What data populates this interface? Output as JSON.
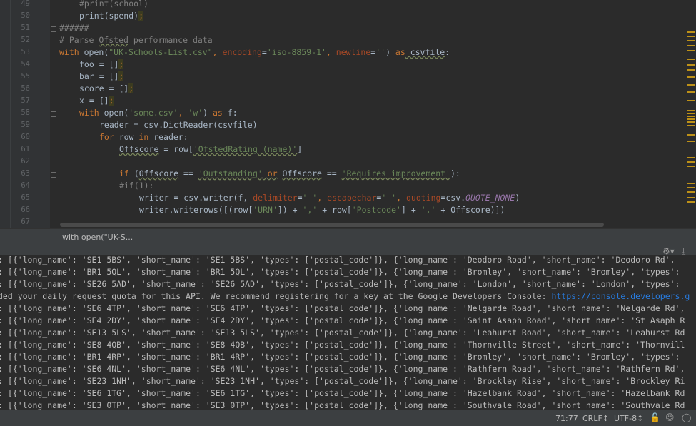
{
  "editor": {
    "line_numbers": [
      "49",
      "50",
      "51",
      "52",
      "53",
      "54",
      "55",
      "56",
      "57",
      "58",
      "59",
      "60",
      "61",
      "62",
      "63",
      "64",
      "65",
      "66",
      "67"
    ],
    "code": {
      "l49": "#print(school)",
      "l50_a": "print(spend)",
      "l50_b": ";",
      "l51": "######",
      "l52_a": "# Parse ",
      "l52_b": "Ofsted",
      "l52_c": " performance data",
      "l53_kw": "with",
      "l53_fn": " open(",
      "l53_s1": "\"UK-Schools-List.csv\"",
      "l53_c1": ", ",
      "l53_p1": "encoding",
      "l53_eq1": "=",
      "l53_s2": "'iso-8859-1'",
      "l53_c2": ", ",
      "l53_p2": "newline",
      "l53_eq2": "=",
      "l53_s3": "''",
      "l53_close": ") ",
      "l53_as": "as",
      "l53_var": " csvfile",
      "l53_colon": ":",
      "l54_a": "foo = []",
      "l54_b": ";",
      "l55_a": "bar = []",
      "l55_b": ";",
      "l56_a": "score = []",
      "l56_b": ";",
      "l57_a": "x = []",
      "l57_b": ";",
      "l58_kw": "with",
      "l58_a": " open(",
      "l58_s1": "'some.csv'",
      "l58_c": ", ",
      "l58_s2": "'w'",
      "l58_b": ") ",
      "l58_as": "as",
      "l58_d": " f:",
      "l59": "reader = csv.DictReader(csvfile)",
      "l60_kw": "for",
      "l60_a": " row ",
      "l60_in": "in",
      "l60_b": " reader:",
      "l61_a": "Offscore",
      "l61_b": " = row[",
      "l61_s": "'OfstedRating (name)'",
      "l61_c": "]",
      "l63_kw": "if",
      "l63_a": " (",
      "l63_v1": "Offscore",
      "l63_b": " == ",
      "l63_s1": "'Outstanding'",
      "l63_or": " or",
      "l63_sp": " ",
      "l63_v2": "Offscore",
      "l63_c": " == ",
      "l63_s2": "'Requires improvement'",
      "l63_d": "):",
      "l64": "#if(1):",
      "l65_a": "writer = csv.writer(f, ",
      "l65_p1": "delimiter",
      "l65_eq1": "=",
      "l65_s1": "' '",
      "l65_c1": ", ",
      "l65_p2": "escapechar",
      "l65_eq2": "=",
      "l65_s2": "' '",
      "l65_c2": ", ",
      "l65_p3": "quoting",
      "l65_eq3": "=csv.",
      "l65_const": "QUOTE_NONE",
      "l65_d": ")",
      "l66_a": "writer.writerows([(row[",
      "l66_s1": "'URN'",
      "l66_b": "]) + ",
      "l66_s2": "','",
      "l66_c": " + row[",
      "l66_s3": "'Postcode'",
      "l66_d": "] + ",
      "l66_s4": "','",
      "l66_e": " + Offscore)])"
    }
  },
  "breadcrumb": "with open(\"UK-S...",
  "console": {
    "lines": [
      ": [{'long_name': 'SE1 5BS', 'short_name': 'SE1 5BS', 'types': ['postal_code']}, {'long_name': 'Deodoro Road', 'short_name': 'Deodoro Rd',",
      ": [{'long_name': 'BR1 5QL', 'short_name': 'BR1 5QL', 'types': ['postal_code']}, {'long_name': 'Bromley', 'short_name': 'Bromley', 'types': ",
      "ded your daily request quota for this API. We recommend registering for a key at the Google Developers Console: ",
      ": [{'long_name': 'SE26 5AD', 'short_name': 'SE26 5AD', 'types': ['postal_code']}, {'long_name': 'London', 'short_name': 'London', 'types': ",
      ": [{'long_name': 'SE6 4TP', 'short_name': 'SE6 4TP', 'types': ['postal_code']}, {'long_name': 'Nelgarde Road', 'short_name': 'Nelgarde Rd',",
      ": [{'long_name': 'SE4 2DY', 'short_name': 'SE4 2DY', 'types': ['postal_code']}, {'long_name': 'Saint Asaph Road', 'short_name': 'St Asaph R",
      ": [{'long_name': 'SE13 5LS', 'short_name': 'SE13 5LS', 'types': ['postal_code']}, {'long_name': 'Leahurst Road', 'short_name': 'Leahurst Rd",
      ": [{'long_name': 'SE8 4QB', 'short_name': 'SE8 4QB', 'types': ['postal_code']}, {'long_name': 'Thornville Street', 'short_name': 'Thornvill",
      ": [{'long_name': 'BR1 4RP', 'short_name': 'BR1 4RP', 'types': ['postal_code']}, {'long_name': 'Bromley', 'short_name': 'Bromley', 'types': ",
      ": [{'long_name': 'SE6 4NL', 'short_name': 'SE6 4NL', 'types': ['postal_code']}, {'long_name': 'Rathfern Road', 'short_name': 'Rathfern Rd',",
      ": [{'long_name': 'SE23 1NH', 'short_name': 'SE23 1NH', 'types': ['postal_code']}, {'long_name': 'Brockley Rise', 'short_name': 'Brockley Ri",
      ": [{'long_name': 'SE6 1TG', 'short_name': 'SE6 1TG', 'types': ['postal_code']}, {'long_name': 'Hazelbank Road', 'short_name': 'Hazelbank Rd",
      ": [{'long_name': 'SE3 0TP', 'short_name': 'SE3 0TP', 'types': ['postal_code']}, {'long_name': 'Southvale Road', 'short_name': 'Southvale Rd"
    ],
    "link": "https://console.developers.g"
  },
  "statusbar": {
    "position": "71:77",
    "line_separator": "CRLF↕",
    "encoding": "UTF-8↕"
  },
  "icons": {
    "settings": "gear-icon",
    "pin": "pin-icon",
    "lock": "lock-icon",
    "inspector": "hector-icon",
    "events": "event-log-icon"
  },
  "colors": {
    "background": "#2b2b2b",
    "keyword": "#cc7832",
    "string": "#6a8759",
    "comment": "#808080",
    "link": "#287bde",
    "warning_marker": "#be9117"
  }
}
